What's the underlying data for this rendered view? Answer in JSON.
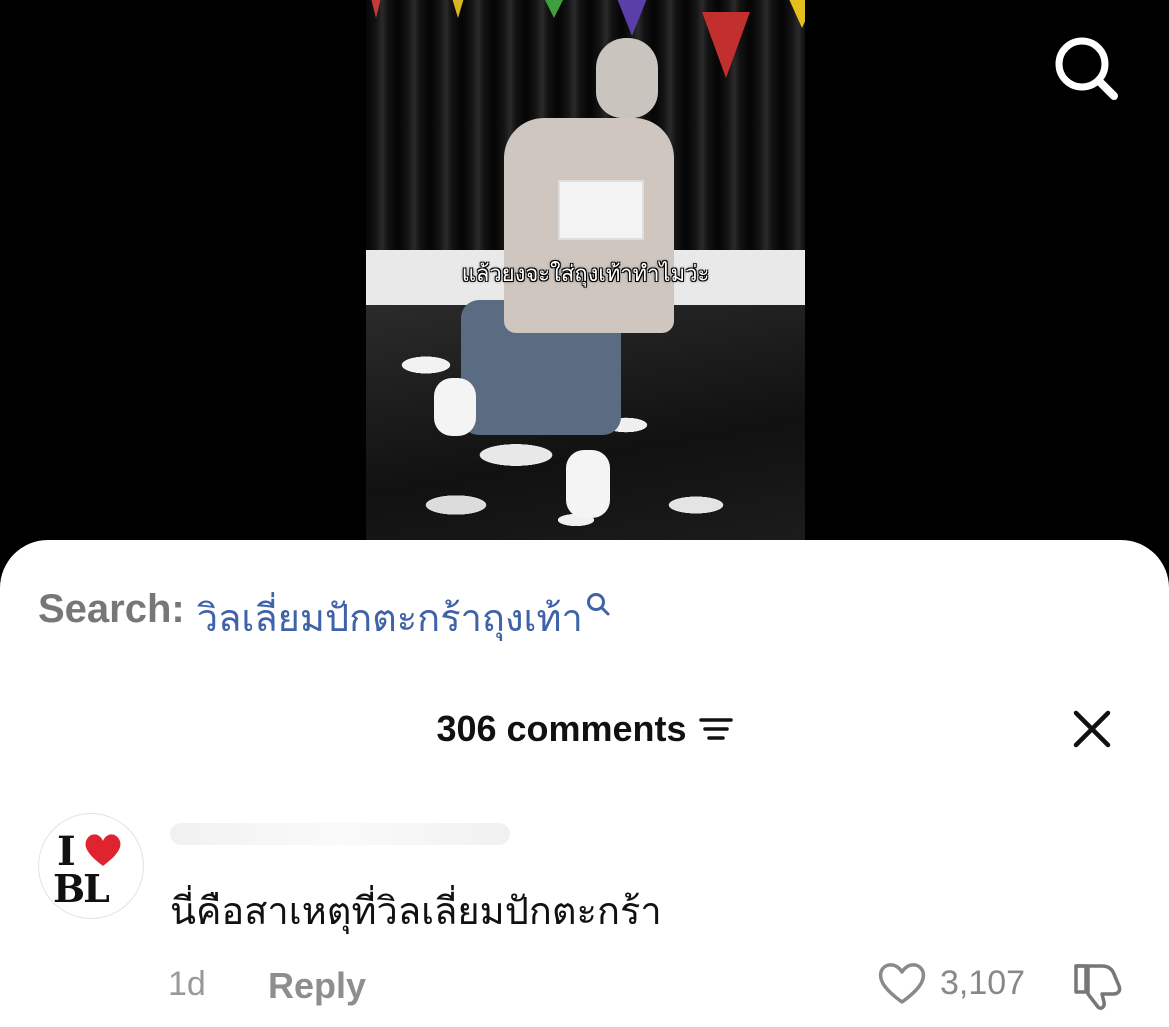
{
  "video": {
    "caption": "แล้วยงจะใส่ถุงเท้าทำไมว่ะ"
  },
  "top_bar": {
    "search_icon": "search-icon"
  },
  "sheet": {
    "search_label": "Search:",
    "search_term": "วิลเลี่ยมปักตะกร้าถุงเท้า",
    "comments_count_label": "306 comments",
    "sort_icon": "sort-icon",
    "close_icon": "close-icon"
  },
  "comment": {
    "avatar_text_top": "I",
    "avatar_text_bottom": "BL",
    "text": "นี่คือสาเหตุที่วิลเลี่ยมปักตะกร้า",
    "age": "1d",
    "reply_label": "Reply",
    "like_count": "3,107",
    "colors": {
      "search_term": "#3f63a8",
      "heart": "#e0242f"
    }
  }
}
